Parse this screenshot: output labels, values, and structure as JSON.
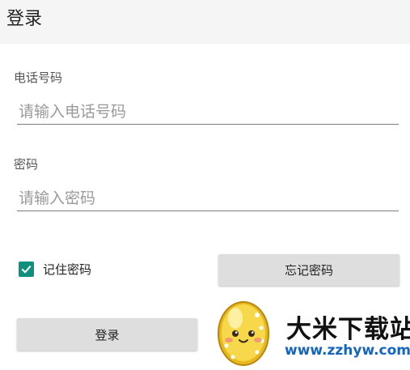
{
  "app_bar": {
    "title": "登录"
  },
  "form": {
    "phone": {
      "label": "电话号码",
      "placeholder": "请输入电话号码",
      "value": ""
    },
    "password": {
      "label": "密码",
      "placeholder": "请输入密码",
      "value": ""
    },
    "remember": {
      "label": "记住密码",
      "checked": true
    },
    "forgot_button": "忘记密码",
    "login_button": "登录"
  },
  "watermark": {
    "brand": "大米下载站",
    "url": "www.zzhyw.com",
    "icon": "egg-mascot-icon"
  },
  "colors": {
    "app_bar_bg": "#f5f5f5",
    "checkbox_accent": "#0f8f7d",
    "button_bg": "#dedede",
    "watermark_url": "#1565c0"
  }
}
